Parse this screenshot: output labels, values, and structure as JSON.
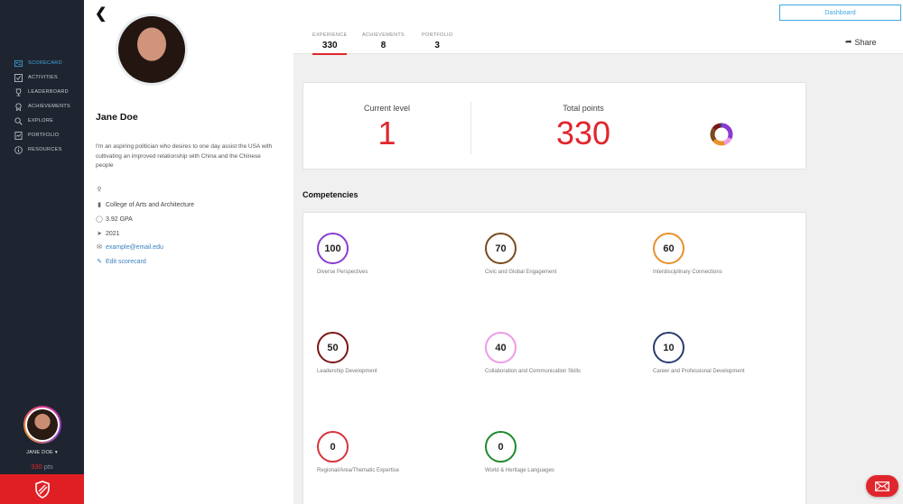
{
  "sidebar": {
    "items": [
      {
        "label": "SCORECARD",
        "icon": "id-card-icon",
        "active": true
      },
      {
        "label": "ACTIVITIES",
        "icon": "checklist-icon",
        "active": false
      },
      {
        "label": "LEADERBOARD",
        "icon": "trophy-icon",
        "active": false
      },
      {
        "label": "ACHIEVEMENTS",
        "icon": "medal-icon",
        "active": false
      },
      {
        "label": "EXPLORE",
        "icon": "search-icon",
        "active": false
      },
      {
        "label": "PORTFOLIO",
        "icon": "portfolio-icon",
        "active": false
      },
      {
        "label": "RESOURCES",
        "icon": "info-icon",
        "active": false
      }
    ],
    "user_name": "JANE DOE",
    "points_value": "330",
    "points_unit": "pts"
  },
  "profile": {
    "name": "Jane Doe",
    "bio": "I'm an aspiring politician who desires to one day assist the USA with cultivating an improved relationship with China and the Chinese people",
    "college": "College of Arts and Architecture",
    "gpa": "3.92 GPA",
    "year": "2021",
    "email": "example@email.edu",
    "edit_label": "Edit scorecard"
  },
  "header": {
    "tabs": [
      {
        "label": "EXPERIENCE",
        "value": "330",
        "active": true
      },
      {
        "label": "ACHIEVEMENTS",
        "value": "8",
        "active": false
      },
      {
        "label": "PORTFOLIO",
        "value": "3",
        "active": false
      }
    ],
    "dashboard_label": "Dashboard",
    "share_label": "Share"
  },
  "stats": {
    "level_label": "Current level",
    "level_value": "1",
    "points_label": "Total points",
    "points_value": "330"
  },
  "competencies": {
    "title": "Competencies",
    "items": [
      {
        "value": "100",
        "name": "Diverse Perspectives",
        "color": "#8a3bd1"
      },
      {
        "value": "70",
        "name": "Civic and Global Engagement",
        "color": "#7a4a1e"
      },
      {
        "value": "60",
        "name": "Interdisciplinary Connections",
        "color": "#e9912c"
      },
      {
        "value": "50",
        "name": "Leadership Development",
        "color": "#7a1616"
      },
      {
        "value": "40",
        "name": "Collaboration and Communication Skills",
        "color": "#ee9ae6"
      },
      {
        "value": "10",
        "name": "Career and Professional Development",
        "color": "#2b3c6e"
      },
      {
        "value": "0",
        "name": "Regional/Area/Thematic Expertise",
        "color": "#d6333b"
      },
      {
        "value": "0",
        "name": "World & Heritage Languages",
        "color": "#1e8a2b"
      }
    ]
  },
  "colors": {
    "accent_red": "#e0262c",
    "accent_blue": "#3fa7e0",
    "sidebar_bg": "#1f2530"
  }
}
